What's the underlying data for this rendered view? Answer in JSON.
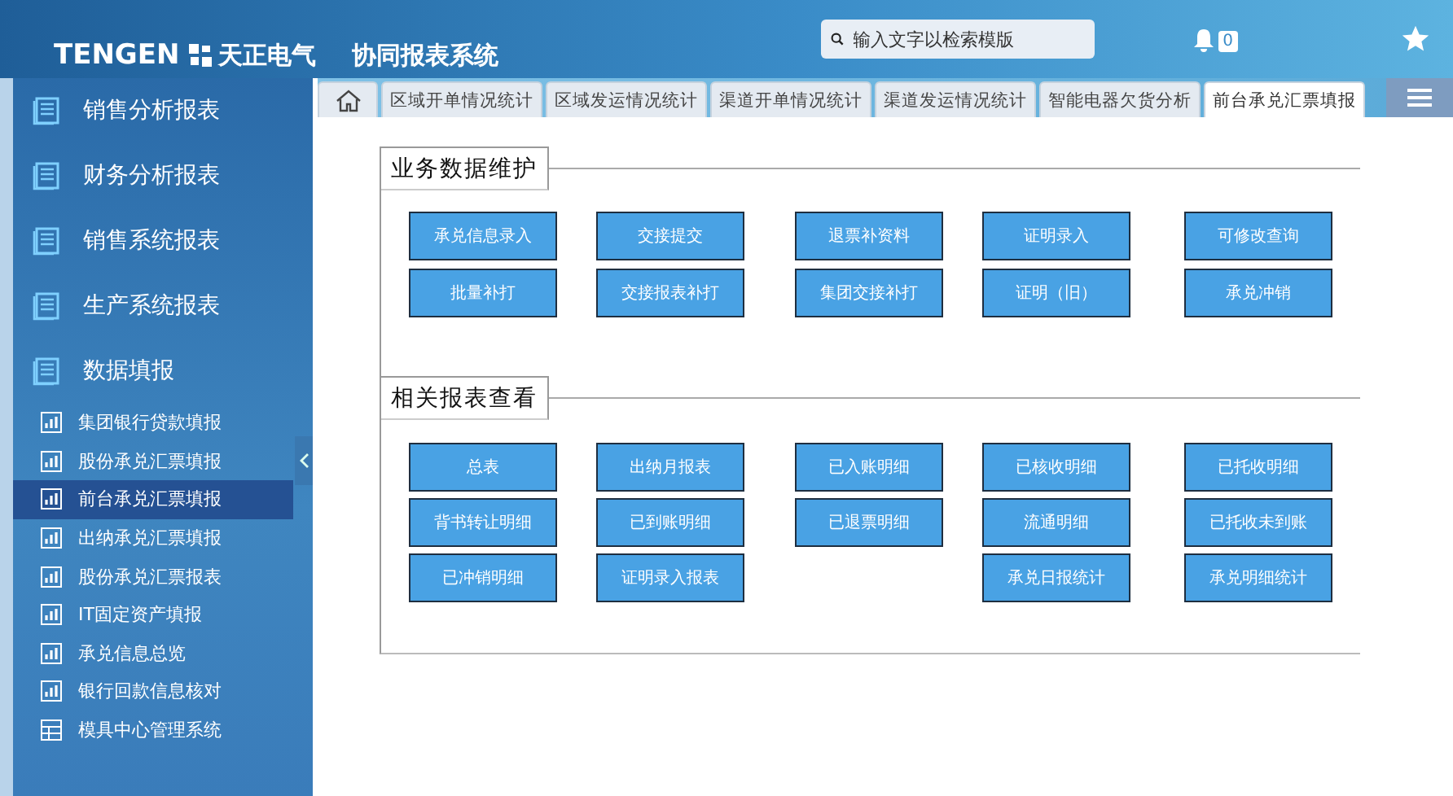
{
  "header": {
    "brand": "TENGEN",
    "brand_cn": "天正电气",
    "title": "协同报表系统",
    "search": {
      "placeholder": "输入文字以检索模版"
    },
    "notifications": "0"
  },
  "sidebar": {
    "items": [
      {
        "label": "销售分析报表",
        "kind": "group"
      },
      {
        "label": "财务分析报表",
        "kind": "group"
      },
      {
        "label": "销售系统报表",
        "kind": "group"
      },
      {
        "label": "生产系统报表",
        "kind": "group"
      },
      {
        "label": "数据填报",
        "kind": "group",
        "children": [
          {
            "label": "集团银行贷款填报",
            "kind": "report",
            "selected": false
          },
          {
            "label": "股份承兑汇票填报",
            "kind": "report",
            "selected": false
          },
          {
            "label": "前台承兑汇票填报",
            "kind": "report",
            "selected": true
          },
          {
            "label": "出纳承兑汇票填报",
            "kind": "report",
            "selected": false
          },
          {
            "label": "股份承兑汇票报表",
            "kind": "report",
            "selected": false
          },
          {
            "label": "IT固定资产填报",
            "kind": "report",
            "selected": false
          },
          {
            "label": "承兑信息总览",
            "kind": "report",
            "selected": false
          },
          {
            "label": "银行回款信息核对",
            "kind": "report",
            "selected": false
          },
          {
            "label": "模具中心管理系统",
            "kind": "system",
            "selected": false
          }
        ]
      }
    ]
  },
  "tabs": [
    {
      "label": "区域开单情况统计",
      "selected": false
    },
    {
      "label": "区域发运情况统计",
      "selected": false
    },
    {
      "label": "渠道开单情况统计",
      "selected": false
    },
    {
      "label": "渠道发运情况统计",
      "selected": false
    },
    {
      "label": "智能电器欠货分析",
      "selected": false
    },
    {
      "label": "前台承兑汇票填报",
      "selected": true
    }
  ],
  "sections": [
    {
      "title": "业务数据维护",
      "rows": [
        [
          "承兑信息录入",
          "交接提交",
          "退票补资料",
          "证明录入",
          "可修改查询"
        ],
        [
          "批量补打",
          "交接报表补打",
          "集团交接补打",
          "证明（旧）",
          "承兑冲销"
        ]
      ]
    },
    {
      "title": "相关报表查看",
      "rows": [
        [
          "总表",
          "出纳月报表",
          "已入账明细",
          "已核收明细",
          "已托收明细"
        ],
        [
          "背书转让明细",
          "已到账明细",
          "已退票明细",
          "流通明细",
          "已托收未到账"
        ],
        [
          "已冲销明细",
          "证明录入报表",
          null,
          "承兑日报统计",
          "承兑明细统计"
        ]
      ]
    }
  ]
}
